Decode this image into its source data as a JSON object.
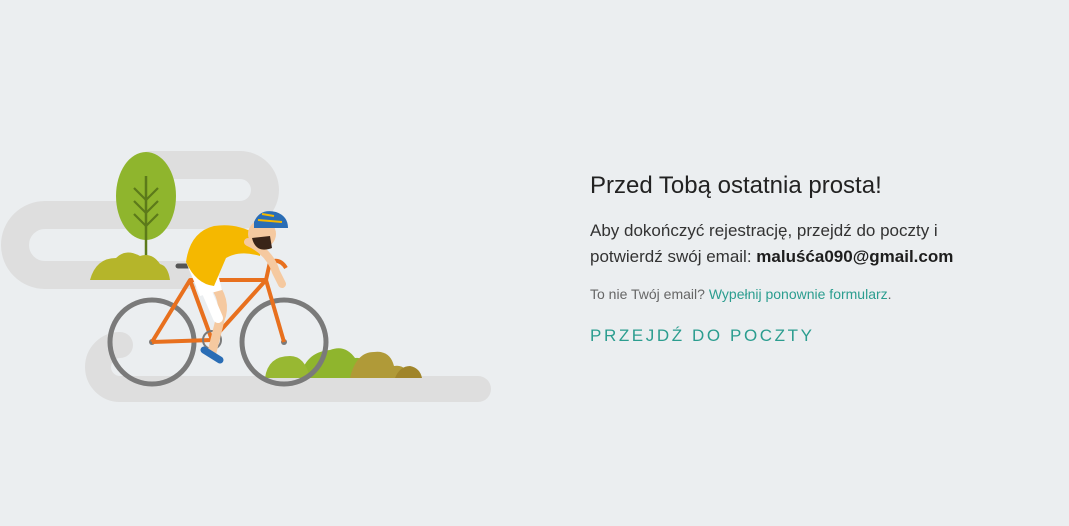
{
  "heading": "Przed Tobą ostatnia prosta!",
  "description_line1": "Aby dokończyć rejestrację, przejdź do poczty i",
  "description_line2": "potwierdź swój email:",
  "email": "maluśća090@gmail.com",
  "hint_text": "To nie Twój email?",
  "hint_link": "Wypełnij ponownie formularz",
  "hint_end": ".",
  "cta_label": "PRZEJDŹ DO POCZTY",
  "colors": {
    "background": "#ebeef0",
    "accent": "#2b9d8f",
    "road": "#dcdcdc",
    "jersey": "#f5b800",
    "bike_frame": "#e8701e",
    "helmet": "#2a6db5",
    "tree": "#8fb52d"
  },
  "illustration": "cyclist-riding-on-winding-road"
}
